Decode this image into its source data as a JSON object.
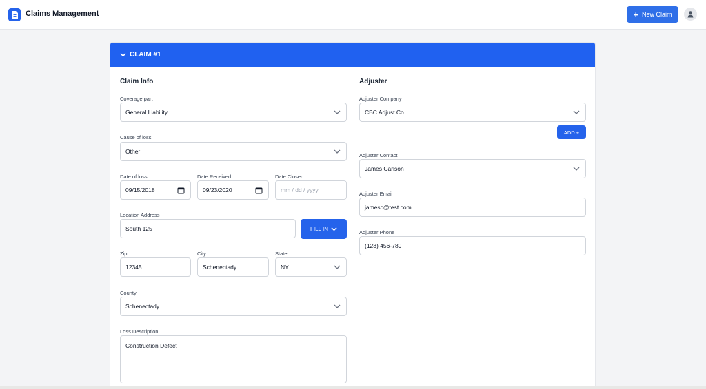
{
  "app": {
    "title": "Claims Management",
    "logo_icon": "document-icon"
  },
  "header": {
    "new_claim_label": "New Claim",
    "avatar_icon": "user-icon"
  },
  "claim": {
    "title": "CLAIM #1"
  },
  "claim_info": {
    "section_title": "Claim Info",
    "coverage_part": {
      "label": "Coverage part",
      "value": "General Liability"
    },
    "cause_of_loss": {
      "label": "Cause of loss",
      "value": "Other"
    },
    "date_of_loss": {
      "label": "Date of loss",
      "value": "09/15/2018"
    },
    "date_received": {
      "label": "Date Received",
      "value": "09/23/2020"
    },
    "date_closed": {
      "label": "Date Closed",
      "placeholder": "mm / dd / yyyy"
    },
    "location_address": {
      "label": "Location Address",
      "value": "South 125"
    },
    "fill_in_label": "FILL IN",
    "zip": {
      "label": "Zip",
      "value": "12345"
    },
    "city": {
      "label": "City",
      "value": "Schenectady"
    },
    "state": {
      "label": "State",
      "value": "NY"
    },
    "county": {
      "label": "County",
      "value": "Schenectady"
    },
    "loss_description": {
      "label": "Loss Description",
      "value": "Construction Defect"
    }
  },
  "adjuster": {
    "section_title": "Adjuster",
    "company": {
      "label": "Adjuster Company",
      "value": "CBC Adjust Co"
    },
    "add_label": "ADD +",
    "contact": {
      "label": "Adjuster Contact",
      "value": "James Carlson"
    },
    "email": {
      "label": "Adjuster Email",
      "value": "jamesc@test.com"
    },
    "phone": {
      "label": "Adjuster Phone",
      "value": "(123) 456-789"
    }
  },
  "colors": {
    "accent": "#2061f0",
    "button": "#2563eb",
    "background": "#f3f4f6"
  }
}
